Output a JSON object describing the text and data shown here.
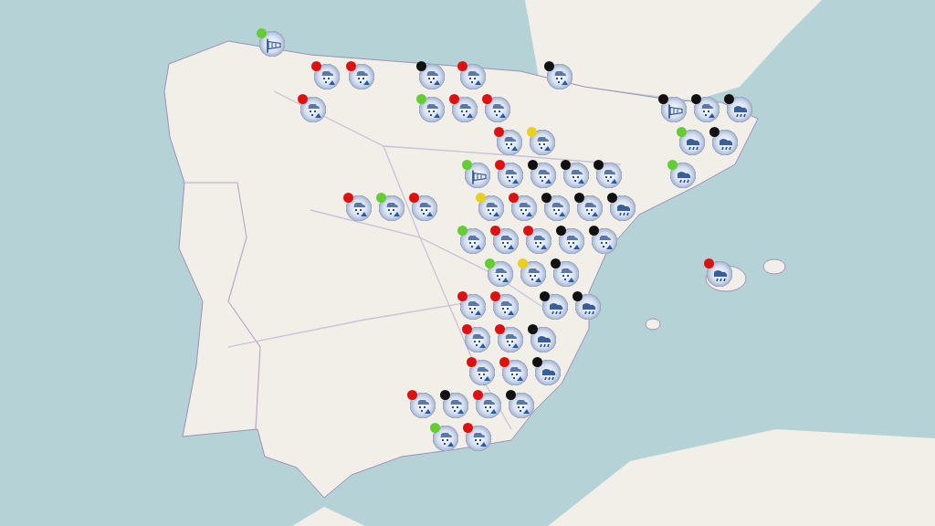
{
  "markers": [
    {
      "kind": "wind",
      "color": "#66cc33"
    },
    {
      "kind": "snow",
      "color": "#dd1111"
    },
    {
      "kind": "snow",
      "color": "#dd1111"
    },
    {
      "kind": "snow",
      "color": "#111111"
    },
    {
      "kind": "snow",
      "color": "#dd1111"
    },
    {
      "kind": "snow",
      "color": "#111111"
    },
    {
      "kind": "snow",
      "color": "#dd1111"
    },
    {
      "kind": "snow",
      "color": "#66cc33"
    },
    {
      "kind": "snow",
      "color": "#dd1111"
    },
    {
      "kind": "snow",
      "color": "#dd1111"
    },
    {
      "kind": "wind",
      "color": "#111111"
    },
    {
      "kind": "snow",
      "color": "#111111"
    },
    {
      "kind": "rain",
      "color": "#111111"
    },
    {
      "kind": "snow",
      "color": "#dd1111"
    },
    {
      "kind": "snow",
      "color": "#e8d020"
    },
    {
      "kind": "rain",
      "color": "#66cc33"
    },
    {
      "kind": "rain",
      "color": "#111111"
    },
    {
      "kind": "wind",
      "color": "#66cc33"
    },
    {
      "kind": "snow",
      "color": "#dd1111"
    },
    {
      "kind": "snow",
      "color": "#111111"
    },
    {
      "kind": "snow",
      "color": "#111111"
    },
    {
      "kind": "snow",
      "color": "#111111"
    },
    {
      "kind": "rain",
      "color": "#66cc33"
    },
    {
      "kind": "snow",
      "color": "#dd1111"
    },
    {
      "kind": "snow",
      "color": "#66cc33"
    },
    {
      "kind": "snow",
      "color": "#dd1111"
    },
    {
      "kind": "snow",
      "color": "#e8d020"
    },
    {
      "kind": "snow",
      "color": "#dd1111"
    },
    {
      "kind": "snow",
      "color": "#111111"
    },
    {
      "kind": "snow",
      "color": "#111111"
    },
    {
      "kind": "rain",
      "color": "#111111"
    },
    {
      "kind": "snow",
      "color": "#66cc33"
    },
    {
      "kind": "snow",
      "color": "#dd1111"
    },
    {
      "kind": "snow",
      "color": "#dd1111"
    },
    {
      "kind": "snow",
      "color": "#111111"
    },
    {
      "kind": "snow",
      "color": "#111111"
    },
    {
      "kind": "snow",
      "color": "#66cc33"
    },
    {
      "kind": "snow",
      "color": "#e8d020"
    },
    {
      "kind": "snow",
      "color": "#111111"
    },
    {
      "kind": "rain",
      "color": "#dd1111"
    },
    {
      "kind": "snow",
      "color": "#dd1111"
    },
    {
      "kind": "snow",
      "color": "#dd1111"
    },
    {
      "kind": "rain",
      "color": "#111111"
    },
    {
      "kind": "rain",
      "color": "#111111"
    },
    {
      "kind": "snow",
      "color": "#dd1111"
    },
    {
      "kind": "snow",
      "color": "#dd1111"
    },
    {
      "kind": "rain",
      "color": "#111111"
    },
    {
      "kind": "snow",
      "color": "#dd1111"
    },
    {
      "kind": "snow",
      "color": "#dd1111"
    },
    {
      "kind": "rain",
      "color": "#111111"
    },
    {
      "kind": "snow",
      "color": "#dd1111"
    },
    {
      "kind": "snow",
      "color": "#111111"
    },
    {
      "kind": "snow",
      "color": "#dd1111"
    },
    {
      "kind": "snow",
      "color": "#111111"
    },
    {
      "kind": "snow",
      "color": "#66cc33"
    },
    {
      "kind": "snow",
      "color": "#dd1111"
    }
  ]
}
